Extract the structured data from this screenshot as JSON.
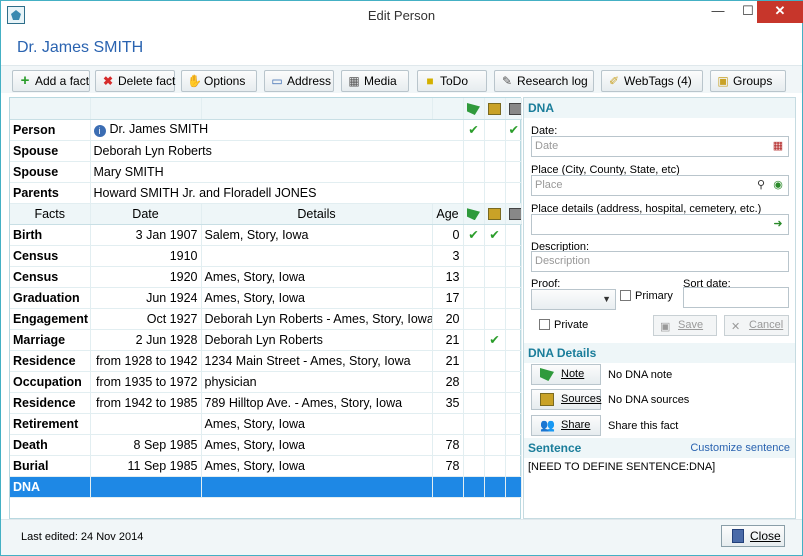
{
  "window": {
    "title": "Edit Person",
    "minimize": "—",
    "maximize": "☐",
    "close": "✕"
  },
  "person_name": "Dr. James SMITH",
  "toolbar": {
    "add_fact": "Add a fact",
    "delete_fact": "Delete fact",
    "options": "Options",
    "address": "Address",
    "media": "Media",
    "todo": "ToDo",
    "research_log": "Research log",
    "webtags": "WebTags (4)",
    "groups": "Groups"
  },
  "relations": [
    {
      "label": "Person",
      "value": "Dr. James SMITH"
    },
    {
      "label": "Spouse",
      "value": "Deborah Lyn Roberts"
    },
    {
      "label": "Spouse",
      "value": "Mary SMITH"
    },
    {
      "label": "Parents",
      "value": "Howard SMITH Jr. and Floradell JONES"
    }
  ],
  "facts_header": {
    "facts": "Facts",
    "date": "Date",
    "details": "Details",
    "age": "Age"
  },
  "facts": [
    {
      "fact": "Birth",
      "date": "3 Jan 1907",
      "details": "Salem, Story, Iowa",
      "age": "0"
    },
    {
      "fact": "Census",
      "date": "1910",
      "details": "",
      "age": "3"
    },
    {
      "fact": "Census",
      "date": "1920",
      "details": "Ames, Story, Iowa",
      "age": "13"
    },
    {
      "fact": "Graduation",
      "date": "Jun 1924",
      "details": "Ames, Story, Iowa",
      "age": "17"
    },
    {
      "fact": "Engagement",
      "date": "Oct 1927",
      "details": "Deborah Lyn Roberts - Ames, Story, Iowa",
      "age": "20"
    },
    {
      "fact": "Marriage",
      "date": "2 Jun 1928",
      "details": "Deborah Lyn Roberts",
      "age": "21"
    },
    {
      "fact": "Residence",
      "date": "from 1928 to 1942",
      "details": "1234 Main Street - Ames, Story, Iowa",
      "age": "21"
    },
    {
      "fact": "Occupation",
      "date": "from 1935 to 1972",
      "details": "physician",
      "age": "28"
    },
    {
      "fact": "Residence",
      "date": "from 1942 to 1985",
      "details": "789 Hilltop Ave. - Ames, Story, Iowa",
      "age": "35"
    },
    {
      "fact": "Retirement",
      "date": "",
      "details": "Ames, Story, Iowa",
      "age": ""
    },
    {
      "fact": "Death",
      "date": "8 Sep 1985",
      "details": "Ames, Story, Iowa",
      "age": "78"
    },
    {
      "fact": "Burial",
      "date": "11 Sep 1985",
      "details": "Ames, Story, Iowa",
      "age": "78"
    },
    {
      "fact": "DNA",
      "date": "",
      "details": "",
      "age": ""
    }
  ],
  "check_glyph": "✔",
  "side": {
    "title": "DNA",
    "date_label": "Date:",
    "date_placeholder": "Date",
    "place_label": "Place (City, County, State, etc)",
    "place_placeholder": "Place",
    "place_details_label": "Place details (address, hospital, cemetery, etc.)",
    "description_label": "Description:",
    "description_placeholder": "Description",
    "proof_label": "Proof:",
    "sort_date_label": "Sort date:",
    "primary": "Primary",
    "private": "Private",
    "save": "Save",
    "cancel": "Cancel",
    "details_title": "DNA Details",
    "note_btn": "Note",
    "note_text": "No DNA note",
    "sources_btn": "Sources",
    "sources_text": "No DNA sources",
    "share_btn": "Share",
    "share_text": "Share this fact",
    "sentence_title": "Sentence",
    "customize": "Customize sentence",
    "sentence_text": "[NEED TO DEFINE SENTENCE:DNA]"
  },
  "status": {
    "last_edited": "Last edited: 24 Nov 2014",
    "close": "Close"
  }
}
